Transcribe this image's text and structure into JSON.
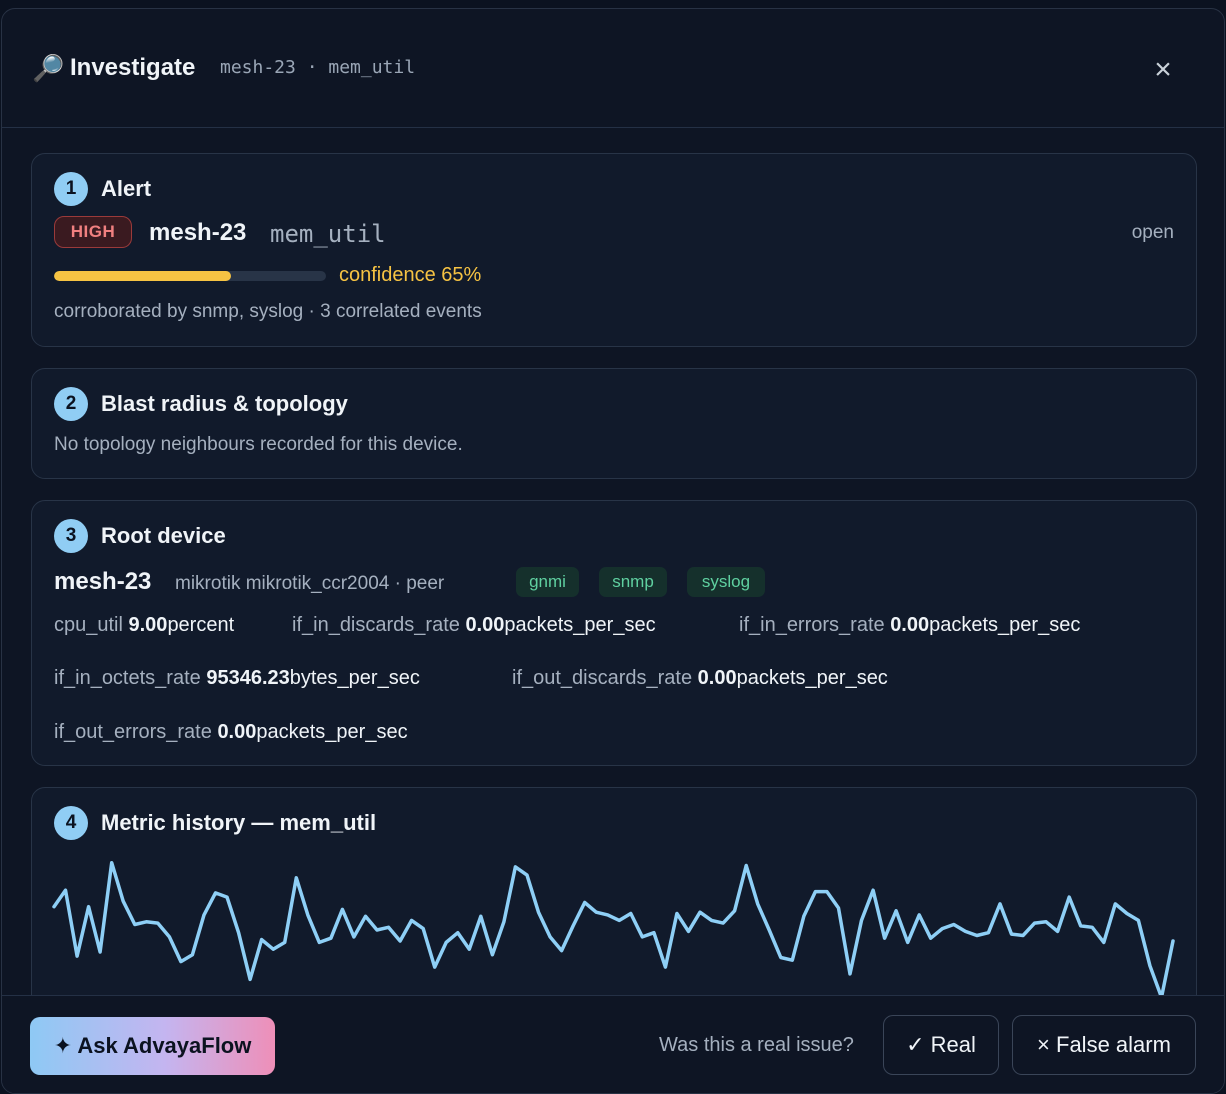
{
  "header": {
    "icon": "🔎",
    "title": "Investigate",
    "subtitle": "mesh-23 · mem_util",
    "close_icon": "×"
  },
  "alert": {
    "step": "1",
    "title": "Alert",
    "severity": "HIGH",
    "device": "mesh-23",
    "metric": "mem_util",
    "status": "open",
    "confidence_value": 0.65,
    "confidence_label": "confidence 65%",
    "corroboration": "corroborated by snmp, syslog · 3 correlated events"
  },
  "blast": {
    "step": "2",
    "title": "Blast radius & topology",
    "message": "No topology neighbours recorded for this device."
  },
  "root": {
    "step": "3",
    "title": "Root device",
    "device": "mesh-23",
    "meta": "mikrotik mikrotik_ccr2004 · peer",
    "tags": [
      "gnmi",
      "snmp",
      "syslog"
    ],
    "metrics": [
      {
        "name": "cpu_util",
        "value": "9.00",
        "unit": "percent"
      },
      {
        "name": "if_in_discards_rate",
        "value": "0.00",
        "unit": "packets_per_sec"
      },
      {
        "name": "if_in_errors_rate",
        "value": "0.00",
        "unit": "packets_per_sec"
      },
      {
        "name": "if_in_octets_rate",
        "value": "95346.23",
        "unit": "bytes_per_sec"
      },
      {
        "name": "if_out_discards_rate",
        "value": "0.00",
        "unit": "packets_per_sec"
      },
      {
        "name": "if_out_errors_rate",
        "value": "0.00",
        "unit": "packets_per_sec"
      }
    ]
  },
  "history": {
    "step": "4",
    "title": "Metric history — mem_util",
    "line_color": "#8ecff6"
  },
  "chart_data": {
    "type": "line",
    "title": "Metric history — mem_util",
    "series": [
      {
        "values": [
          38,
          50,
          2,
          38,
          5,
          70,
          42,
          25,
          27,
          26,
          16,
          -2,
          3,
          32,
          48,
          45,
          19,
          -15,
          14,
          7,
          12,
          59,
          32,
          12,
          15,
          36,
          16,
          31,
          21,
          23,
          13,
          28,
          22,
          -6,
          12,
          19,
          7,
          31,
          3,
          27,
          67,
          61,
          34,
          16,
          6,
          24,
          41,
          34,
          32,
          28,
          33,
          16,
          19,
          -6,
          33,
          20,
          34,
          28,
          26,
          35,
          68,
          40,
          21,
          1,
          -1,
          31,
          49,
          49,
          37,
          -11,
          28,
          50,
          15,
          35,
          12,
          32,
          15,
          22,
          25,
          20,
          17,
          19,
          40,
          18,
          17,
          26,
          27,
          20,
          45,
          24,
          23,
          12,
          40,
          33,
          28,
          -5,
          -28,
          13
        ]
      }
    ]
  },
  "footer": {
    "ask_label": "✦ Ask AdvayaFlow",
    "question": "Was this a real issue?",
    "real_label": "✓ Real",
    "false_label": "× False alarm"
  }
}
